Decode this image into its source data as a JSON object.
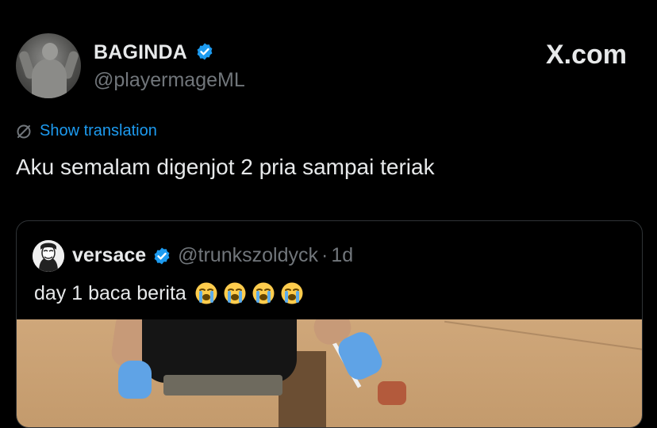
{
  "tweet": {
    "author_name": "BAGINDA",
    "author_handle": "@playermageML",
    "verified": true,
    "site_logo": "X.com",
    "translate_label": "Show translation",
    "translate_icon": "translate-slash-icon",
    "text": "Aku semalam digenjot 2 pria sampai teriak"
  },
  "quote": {
    "author_name": "versace",
    "verified": true,
    "author_handle": "@trunkszoldyck",
    "separator": "·",
    "time": "1d",
    "text": "day 1 baca berita",
    "emojis": [
      "loudly-crying-face",
      "loudly-crying-face",
      "loudly-crying-face",
      "loudly-crying-face"
    ]
  },
  "colors": {
    "background": "#000000",
    "text": "#e7e9ea",
    "muted": "#71767b",
    "accent": "#1d9bf0",
    "verified_badge": "#1d9bf0",
    "border": "#2f3336"
  }
}
